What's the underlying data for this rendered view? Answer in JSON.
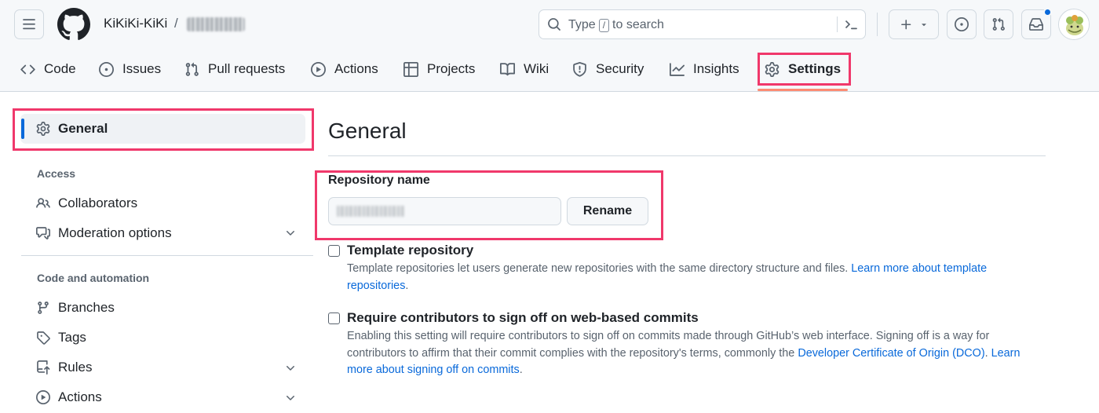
{
  "header": {
    "owner": "KiKiKi-KiKi",
    "separator": "/",
    "search": {
      "prefix": "Type",
      "key": "/",
      "suffix": "to search"
    }
  },
  "repo_nav": {
    "tabs": [
      {
        "label": "Code",
        "icon": "code-icon"
      },
      {
        "label": "Issues",
        "icon": "issue-opened-icon"
      },
      {
        "label": "Pull requests",
        "icon": "git-pull-request-icon"
      },
      {
        "label": "Actions",
        "icon": "play-icon"
      },
      {
        "label": "Projects",
        "icon": "table-icon"
      },
      {
        "label": "Wiki",
        "icon": "book-icon"
      },
      {
        "label": "Security",
        "icon": "shield-icon"
      },
      {
        "label": "Insights",
        "icon": "graph-icon"
      },
      {
        "label": "Settings",
        "icon": "gear-icon",
        "active": true
      }
    ]
  },
  "sidebar": {
    "general": "General",
    "sections": [
      {
        "heading": "Access",
        "items": [
          {
            "label": "Collaborators"
          },
          {
            "label": "Moderation options",
            "expandable": true
          }
        ]
      },
      {
        "heading": "Code and automation",
        "items": [
          {
            "label": "Branches"
          },
          {
            "label": "Tags"
          },
          {
            "label": "Rules",
            "expandable": true
          },
          {
            "label": "Actions",
            "expandable": true
          }
        ]
      }
    ]
  },
  "main": {
    "title": "General",
    "repo_name_label": "Repository name",
    "rename_button": "Rename",
    "template": {
      "title": "Template repository",
      "desc": "Template repositories let users generate new repositories with the same directory structure and files. ",
      "link": "Learn more about template repositories",
      "tail": "."
    },
    "signoff": {
      "title": "Require contributors to sign off on web-based commits",
      "desc": "Enabling this setting will require contributors to sign off on commits made through GitHub’s web interface. Signing off is a way for contributors to affirm that their commit complies with the repository's terms, commonly the ",
      "link1": "Developer Certificate of Origin (DCO)",
      "mid": ". ",
      "link2": "Learn more about signing off on commits",
      "tail": "."
    }
  },
  "colors": {
    "accent": "#0969da",
    "highlight": "#f0386b",
    "tab_underline": "#fd8c73"
  }
}
